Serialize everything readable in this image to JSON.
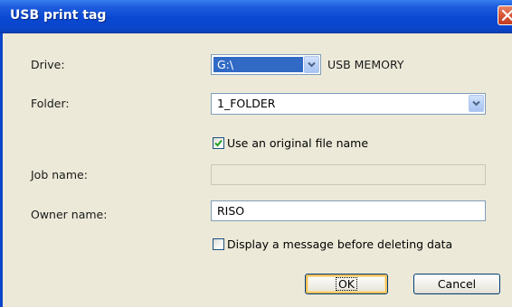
{
  "dialog": {
    "title": "USB print tag"
  },
  "drive": {
    "label": "Drive:",
    "value": "G:\\",
    "type_label": "USB MEMORY"
  },
  "folder": {
    "label": "Folder:",
    "value": "1_FOLDER"
  },
  "use_original_name": {
    "label": "Use an original file name",
    "checked": true
  },
  "job_name": {
    "label": "Job name:",
    "value": ""
  },
  "owner_name": {
    "label": "Owner name:",
    "value": "RISO"
  },
  "display_message": {
    "label": "Display a message before deleting data",
    "checked": false
  },
  "buttons": {
    "ok": "OK",
    "cancel": "Cancel"
  },
  "icons": {
    "close": "close-icon",
    "dropdown": "chevron-down-icon",
    "check": "check-icon"
  },
  "colors": {
    "titlebar": "#0a48d2",
    "selection": "#316ac5",
    "dialog_bg": "#ece9d8",
    "close_button": "#d85a3a"
  }
}
